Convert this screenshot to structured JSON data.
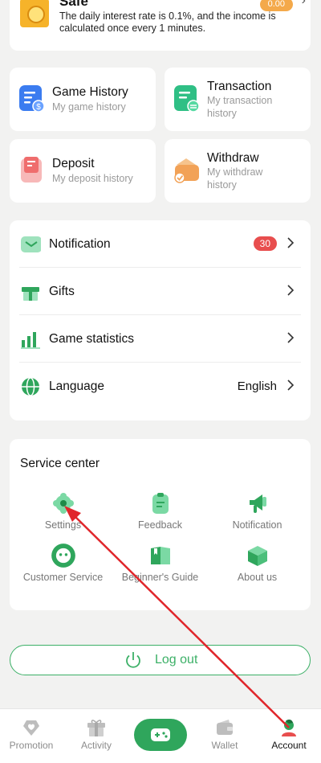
{
  "safe": {
    "title": "Safe",
    "badge": "0.00",
    "description": "The daily interest rate is 0.1%, and the income is calculated once every 1 minutes."
  },
  "tiles": [
    {
      "title": "Game History",
      "subtitle": "My game history",
      "icon": "game-history-icon",
      "color": "#3b7cf0"
    },
    {
      "title": "Transaction",
      "subtitle": "My transaction history",
      "icon": "transaction-icon",
      "color": "#2fbf85"
    },
    {
      "title": "Deposit",
      "subtitle": "My deposit history",
      "icon": "deposit-icon",
      "color": "#ef6d6d"
    },
    {
      "title": "Withdraw",
      "subtitle": "My withdraw history",
      "icon": "withdraw-icon",
      "color": "#f2a257"
    }
  ],
  "menu": {
    "notification": {
      "label": "Notification",
      "badge": "30"
    },
    "gifts": {
      "label": "Gifts"
    },
    "game_statistics": {
      "label": "Game statistics"
    },
    "language": {
      "label": "Language",
      "value": "English"
    }
  },
  "service": {
    "title": "Service center",
    "items": [
      {
        "label": "Settings",
        "icon": "settings-icon"
      },
      {
        "label": "Feedback",
        "icon": "feedback-icon"
      },
      {
        "label": "Notification",
        "icon": "notification-icon"
      },
      {
        "label": "Customer Service",
        "icon": "customer-service-icon"
      },
      {
        "label": "Beginner's Guide",
        "icon": "beginners-guide-icon"
      },
      {
        "label": "About us",
        "icon": "about-us-icon"
      }
    ]
  },
  "logout": {
    "label": "Log out"
  },
  "tabbar": {
    "promotion": "Promotion",
    "activity": "Activity",
    "wallet": "Wallet",
    "account": "Account",
    "active": "account"
  },
  "colors": {
    "accent": "#3cb067",
    "badge": "#e84e4e",
    "annotation": "#e0262b"
  }
}
